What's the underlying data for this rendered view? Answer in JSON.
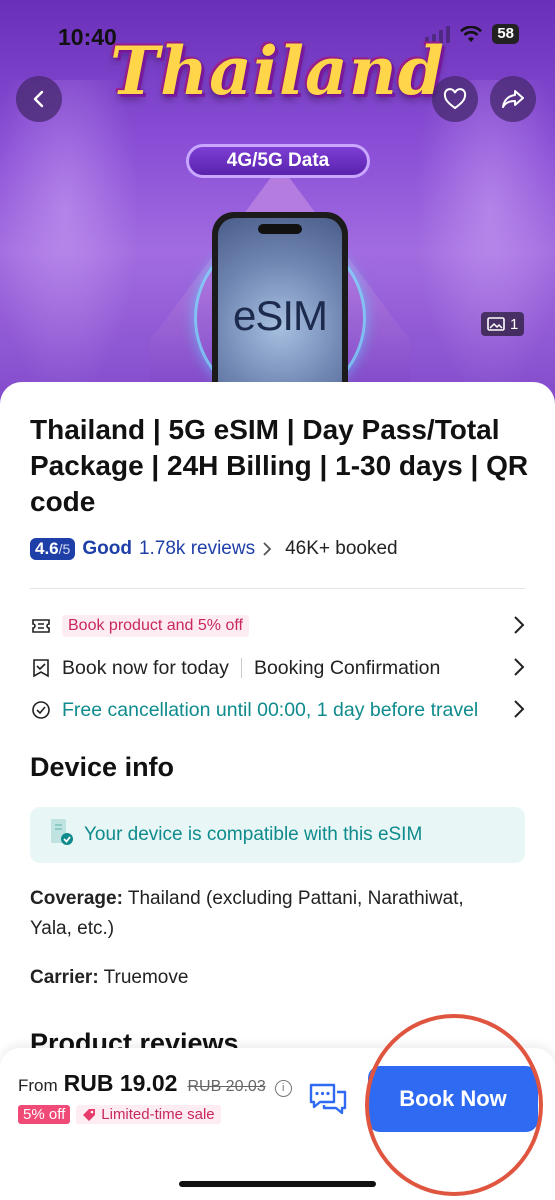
{
  "status_bar": {
    "time": "10:40",
    "battery": "58"
  },
  "hero": {
    "title": "Thailand",
    "badge": "4G/5G Data",
    "phone_label": "eSIM",
    "image_count": "1"
  },
  "product": {
    "title": "Thailand | 5G eSIM | Day Pass/Total Package | 24H Billing | 1-30 days | QR code",
    "rating_score": "4.6",
    "rating_max": "/5",
    "rating_word": "Good",
    "reviews": "1.78k reviews",
    "booked": "46K+ booked"
  },
  "info_rows": {
    "promo": "Book product and 5% off",
    "book_today": "Book now for today",
    "confirmation": "Booking Confirmation",
    "cancellation": "Free cancellation until 00:00, 1 day before travel"
  },
  "device_info": {
    "heading": "Device info",
    "compat_text": "Your device is compatible with this eSIM",
    "coverage_label": "Coverage:",
    "coverage_value": " Thailand (excluding Pattani, Narathiwat, Yala, etc.)",
    "carrier_label": "Carrier:",
    "carrier_value": " Truemove"
  },
  "reviews_section": {
    "heading": "Product reviews"
  },
  "bottom_bar": {
    "from": "From",
    "price": "RUB 19.02",
    "old_price": "RUB 20.03",
    "off_tag": "5% off",
    "sale_tag": "Limited-time sale",
    "book_button": "Book Now"
  },
  "colors": {
    "brand_blue": "#2f6bf2",
    "rating_blue": "#1f3fa8",
    "teal": "#0f8b8d",
    "promo_pink": "#c8285f",
    "highlight_ring": "#e0553f"
  }
}
